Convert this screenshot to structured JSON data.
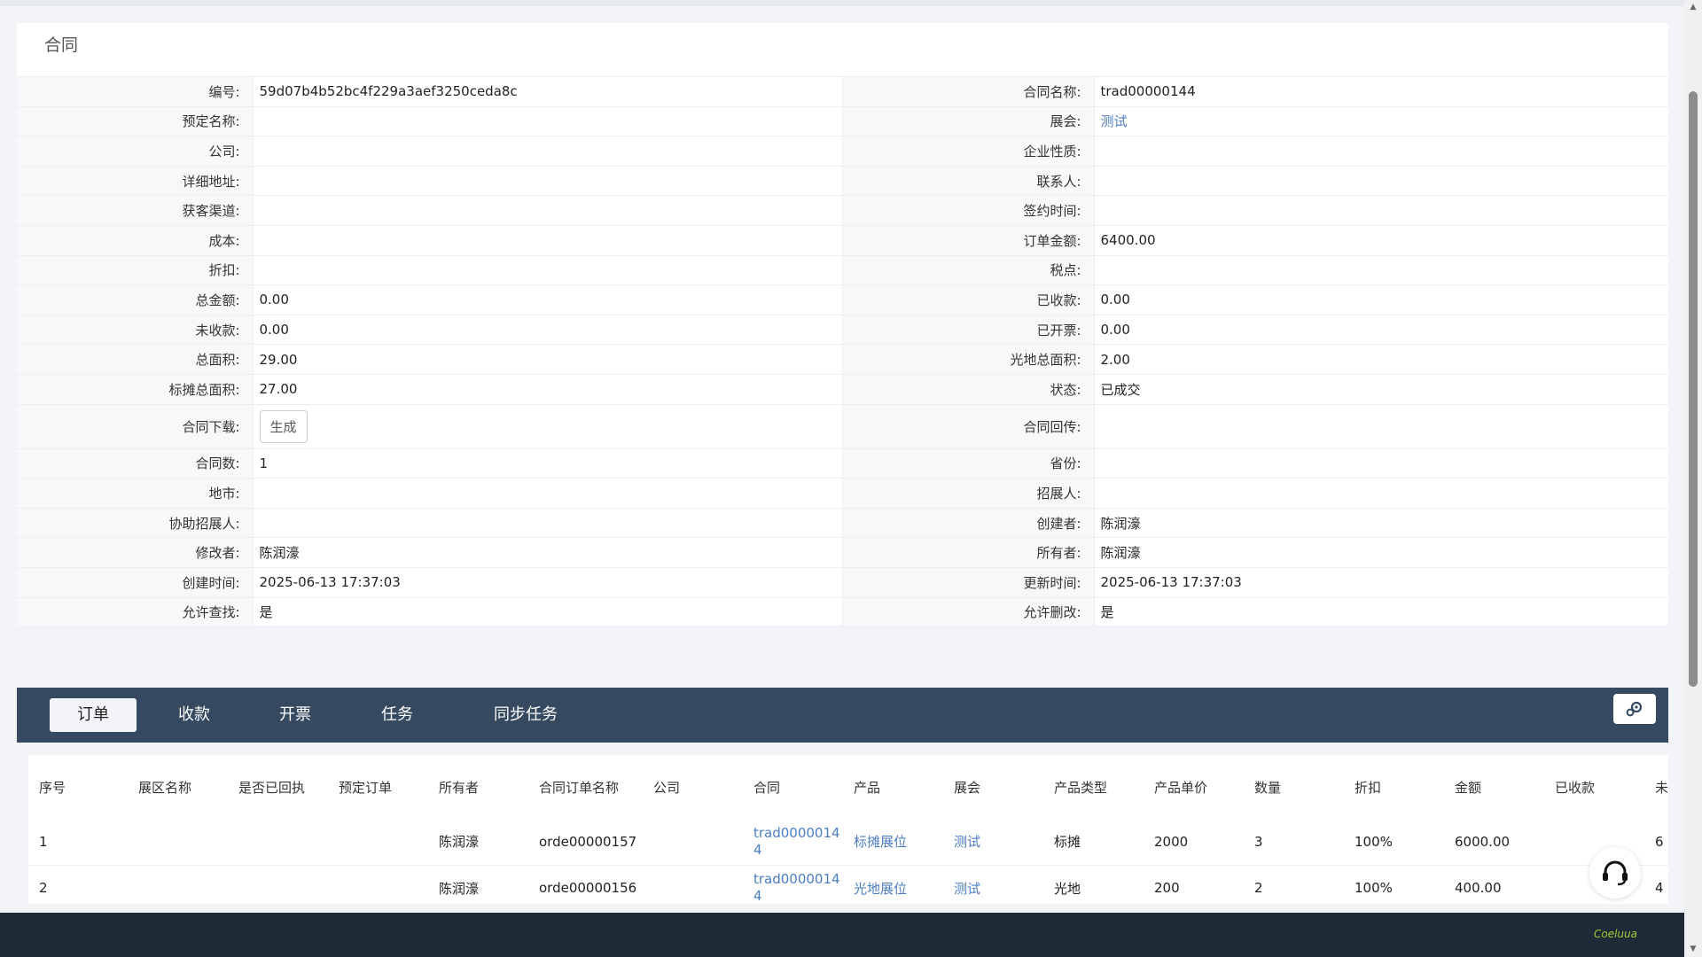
{
  "card": {
    "title": "合同"
  },
  "detail": {
    "rows": [
      [
        "编号:",
        "59d07b4b52bc4f229a3aef3250ceda8c",
        "合同名称:",
        "trad00000144"
      ],
      [
        "预定名称:",
        "",
        "展会:",
        "测试"
      ],
      [
        "公司:",
        "",
        "企业性质:",
        ""
      ],
      [
        "详细地址:",
        "",
        "联系人:",
        ""
      ],
      [
        "获客渠道:",
        "",
        "签约时间:",
        ""
      ],
      [
        "成本:",
        "",
        "订单金额:",
        "6400.00"
      ],
      [
        "折扣:",
        "",
        "税点:",
        ""
      ],
      [
        "总金额:",
        "0.00",
        "已收款:",
        "0.00"
      ],
      [
        "未收款:",
        "0.00",
        "已开票:",
        "0.00"
      ],
      [
        "总面积:",
        "29.00",
        "光地总面积:",
        "2.00"
      ],
      [
        "标摊总面积:",
        "27.00",
        "状态:",
        "已成交"
      ],
      [
        "合同下载:",
        "生成",
        "合同回传:",
        ""
      ],
      [
        "合同数:",
        "1",
        "省份:",
        ""
      ],
      [
        "地市:",
        "",
        "招展人:",
        ""
      ],
      [
        "协助招展人:",
        "",
        "创建者:",
        "陈润濠"
      ],
      [
        "修改者:",
        "陈润濠",
        "所有者:",
        "陈润濠"
      ],
      [
        "创建时间:",
        "2025-06-13 17:37:03",
        "更新时间:",
        "2025-06-13 17:37:03"
      ],
      [
        "允许查找:",
        "是",
        "允许删改:",
        "是"
      ]
    ]
  },
  "tabs": [
    "订单",
    "收款",
    "开票",
    "任务",
    "同步任务"
  ],
  "list": {
    "headers": [
      "序号",
      "展区名称",
      "是否已回执",
      "预定订单",
      "所有者",
      "合同订单名称",
      "公司",
      "合同",
      "产品",
      "展会",
      "产品类型",
      "产品单价",
      "数量",
      "折扣",
      "金额",
      "已收款",
      "未"
    ],
    "rows": [
      [
        "1",
        "",
        "",
        "",
        "陈润濠",
        "orde00000157",
        "",
        "trad00000144",
        "标摊展位",
        "测试",
        "标摊",
        "2000",
        "3",
        "100%",
        "6000.00",
        "",
        "6"
      ],
      [
        "2",
        "",
        "",
        "",
        "陈润濠",
        "orde00000156",
        "",
        "trad00000144",
        "光地展位",
        "测试",
        "光地",
        "200",
        "2",
        "100%",
        "400.00",
        "",
        "4"
      ]
    ]
  },
  "footer": {
    "brand": "Coeluua"
  },
  "colors": {
    "link": "#4c7dc2",
    "tabbar": "#354960",
    "footer": "#1f2a37",
    "brand": "#9acd32"
  }
}
